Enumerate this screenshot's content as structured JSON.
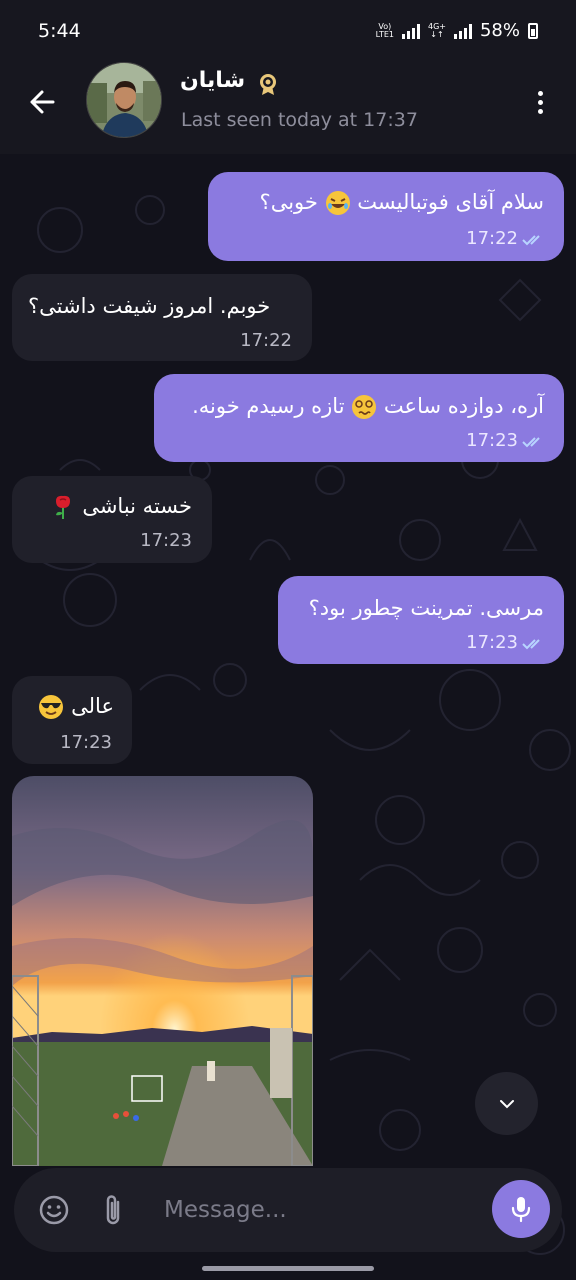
{
  "status_bar": {
    "time": "5:44",
    "volte_top": "Vo)",
    "volte_bottom": "LTE1",
    "network_top": "4G+",
    "network_bottom": "↓↑",
    "battery": "58%"
  },
  "header": {
    "contact_name": "شایان",
    "last_seen": "Last seen today at 17:37"
  },
  "messages": [
    {
      "direction": "out",
      "text": "سلام آقای فوتبالیست",
      "emoji": "laughing-emoji",
      "text_after": "خوبی؟",
      "time": "17:22"
    },
    {
      "direction": "in",
      "text": "خوبم. امروز شیفت داشتی؟",
      "time": "17:22"
    },
    {
      "direction": "out",
      "text": "آره، دوازده ساعت",
      "emoji": "dizzy-face-emoji",
      "text_after": "تازه رسیدم خونه.",
      "time": "17:23"
    },
    {
      "direction": "in",
      "text": "خسته نباشی",
      "emoji": "rose-emoji",
      "time": "17:23"
    },
    {
      "direction": "out",
      "text": "مرسی. تمرینت چطور بود؟",
      "time": "17:23"
    },
    {
      "direction": "in",
      "text": "عالی",
      "emoji": "sunglasses-emoji",
      "time": "17:23"
    }
  ],
  "input": {
    "placeholder": "Message..."
  },
  "colors": {
    "accent": "#8b7ae0",
    "incoming_bubble": "#20202a",
    "background": "#12121b"
  }
}
